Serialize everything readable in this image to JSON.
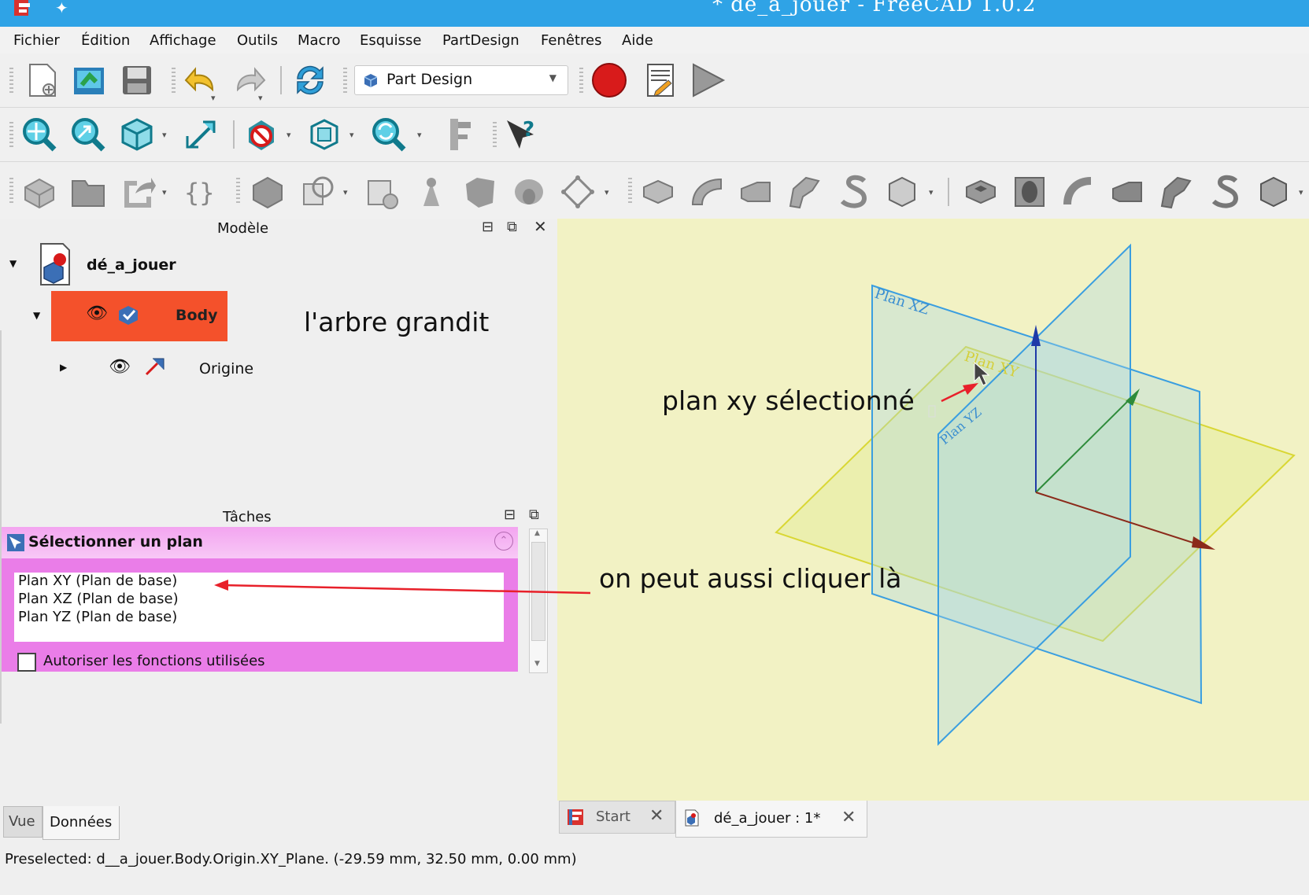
{
  "window": {
    "title": "* dé_a_jouer - FreeCAD 1.0.2"
  },
  "menu": [
    "Fichier",
    "Édition",
    "Affichage",
    "Outils",
    "Macro",
    "Esquisse",
    "PartDesign",
    "Fenêtres",
    "Aide"
  ],
  "workbench": {
    "selected": "Part Design"
  },
  "model_panel": {
    "title": "Modèle",
    "tree": {
      "document": "dé_a_jouer",
      "body": "Body",
      "origin": "Origine"
    }
  },
  "tasks_panel": {
    "title": "Tâches",
    "section_title": "Sélectionner un plan",
    "planes": [
      "Plan XY (Plan de base)",
      "Plan XZ (Plan de base)",
      "Plan YZ (Plan de base)"
    ],
    "checkbox_label": "Autoriser les fonctions utilisées",
    "checkbox_checked": false
  },
  "annotations": {
    "tree_grows": "l'arbre grandit",
    "xy_selected": "plan xy sélectionné",
    "click_here": "on peut aussi cliquer là"
  },
  "viewport": {
    "plane_labels": {
      "xz": "Plan XZ",
      "xy": "Plan XY",
      "yz": "Plan YZ"
    }
  },
  "bottom_tabs": [
    "Vue",
    "Données"
  ],
  "doc_tabs": [
    "Start",
    "dé_a_jouer : 1*"
  ],
  "status_bar": "Preselected: d__a_jouer.Body.Origin.XY_Plane. (-29.59 mm, 32.50 mm, 0.00 mm)",
  "colors": {
    "titlebar": "#2fa3e6",
    "body_highlight": "#f4512b",
    "task_panel": "#ea7de8",
    "viewport_bg": "#f2f2c4",
    "annotation_arrow": "#e8202a"
  }
}
